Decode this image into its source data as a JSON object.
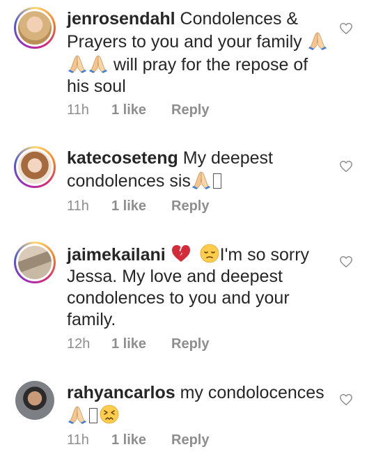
{
  "comments": [
    {
      "username": "jenrosendahl",
      "text_before": "Condolences & Prayers to you and your family",
      "pray_count": 3,
      "text_after": " will pray for the repose of his soul",
      "time": "11h",
      "likes": "1 like",
      "reply": "Reply"
    },
    {
      "username": "katecoseteng",
      "text_before": "My deepest condolences sis",
      "time": "11h",
      "likes": "1 like",
      "reply": "Reply"
    },
    {
      "username": "jaimekailani",
      "text_after": "I'm so sorry Jessa. My love and deepest condolences to you and your family.",
      "time": "12h",
      "likes": "1 like",
      "reply": "Reply"
    },
    {
      "username": "rahyancarlos",
      "text_before": "my condolocences",
      "time": "11h",
      "likes": "1 like",
      "reply": "Reply"
    }
  ],
  "icons": {
    "heart": "heart-outline-icon",
    "pray": "folded-hands-emoji",
    "broken_heart": "broken-heart-emoji",
    "pensive": "pensive-face-emoji",
    "persevering": "persevering-face-emoji"
  },
  "colors": {
    "text": "#262626",
    "meta": "#8e8e8e",
    "heart_stroke": "#8e8e8e"
  }
}
